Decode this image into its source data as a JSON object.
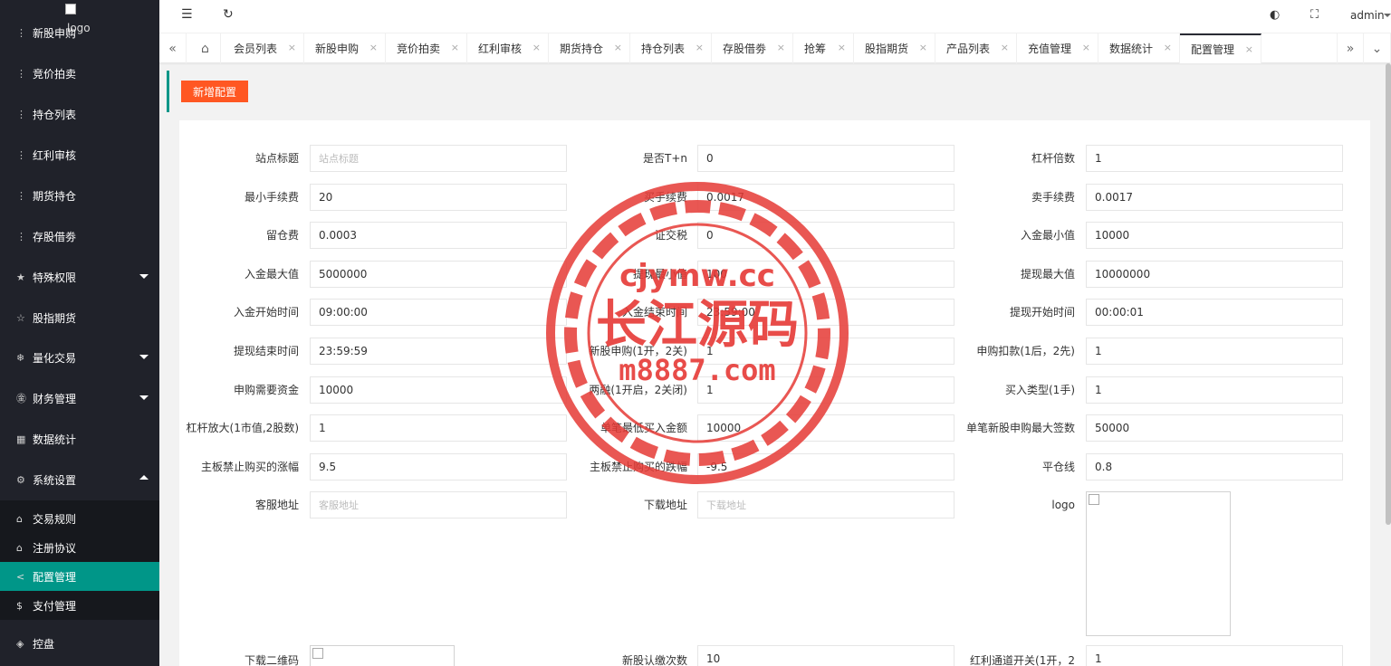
{
  "sidebar": {
    "logo_text": "logo",
    "items": [
      {
        "label": "新股申购",
        "icon": "dots-icon"
      },
      {
        "label": "竞价拍卖",
        "icon": "dots-icon"
      },
      {
        "label": "持仓列表",
        "icon": "dots-icon"
      },
      {
        "label": "红利审核",
        "icon": "dots-icon"
      },
      {
        "label": "期货持仓",
        "icon": "dots-icon"
      },
      {
        "label": "存股借劵",
        "icon": "dots-icon"
      },
      {
        "label": "特殊权限",
        "icon": "star-icon"
      },
      {
        "label": "股指期货",
        "icon": "star-outline-icon"
      },
      {
        "label": "量化交易",
        "icon": "snowflake-icon"
      },
      {
        "label": "财务管理",
        "icon": "yen-icon"
      },
      {
        "label": "数据统计",
        "icon": "calendar-icon"
      },
      {
        "label": "系统设置",
        "icon": "gear-icon"
      }
    ],
    "sub_items": [
      {
        "label": "交易规则",
        "icon": "building-icon"
      },
      {
        "label": "注册协议",
        "icon": "building-icon"
      },
      {
        "label": "配置管理",
        "icon": "share-icon"
      },
      {
        "label": "支付管理",
        "icon": "dollar-icon"
      }
    ],
    "bottom_item": {
      "label": "控盘",
      "icon": "cube-icon"
    }
  },
  "header": {
    "user": "admin"
  },
  "tabs": [
    {
      "label": "会员列表"
    },
    {
      "label": "新股申购"
    },
    {
      "label": "竞价拍卖"
    },
    {
      "label": "红利审核"
    },
    {
      "label": "期货持仓"
    },
    {
      "label": "持仓列表"
    },
    {
      "label": "存股借劵"
    },
    {
      "label": "抢筹"
    },
    {
      "label": "股指期货"
    },
    {
      "label": "产品列表"
    },
    {
      "label": "充值管理"
    },
    {
      "label": "数据统计"
    },
    {
      "label": "配置管理"
    }
  ],
  "toolbar": {
    "add_label": "新增配置"
  },
  "form": {
    "rows": [
      [
        {
          "label": "站点标题",
          "value": "",
          "placeholder": "站点标题"
        },
        {
          "label": "是否T+n",
          "value": "0"
        },
        {
          "label": "杠杆倍数",
          "value": "1"
        }
      ],
      [
        {
          "label": "最小手续费",
          "value": "20"
        },
        {
          "label": "买手续费",
          "value": "0.0017"
        },
        {
          "label": "卖手续费",
          "value": "0.0017"
        }
      ],
      [
        {
          "label": "留仓费",
          "value": "0.0003"
        },
        {
          "label": "证交税",
          "value": "0"
        },
        {
          "label": "入金最小值",
          "value": "10000"
        }
      ],
      [
        {
          "label": "入金最大值",
          "value": "5000000"
        },
        {
          "label": "提现最小值",
          "value": "100"
        },
        {
          "label": "提现最大值",
          "value": "10000000"
        }
      ],
      [
        {
          "label": "入金开始时间",
          "value": "09:00:00"
        },
        {
          "label": "入金结束时间",
          "value": "23:59:00"
        },
        {
          "label": "提现开始时间",
          "value": "00:00:01"
        }
      ],
      [
        {
          "label": "提现结束时间",
          "value": "23:59:59"
        },
        {
          "label": "新股申购(1开，2关)",
          "value": "1"
        },
        {
          "label": "申购扣款(1后，2先)",
          "value": "1"
        }
      ],
      [
        {
          "label": "申购需要资金",
          "value": "10000"
        },
        {
          "label": "两融(1开启，2关闭)",
          "value": "1"
        },
        {
          "label": "买入类型(1手)",
          "value": "1"
        }
      ],
      [
        {
          "label": "杠杆放大(1市值,2股数)",
          "value": "1"
        },
        {
          "label": "单笔最低买入金额",
          "value": "10000"
        },
        {
          "label": "单笔新股申购最大签数",
          "value": "50000"
        }
      ],
      [
        {
          "label": "主板禁止购买的涨幅",
          "value": "9.5"
        },
        {
          "label": "主板禁止购买的跌幅",
          "value": "-9.5"
        },
        {
          "label": "平仓线",
          "value": "0.8"
        }
      ],
      [
        {
          "label": "客服地址",
          "value": "",
          "placeholder": "客服地址"
        },
        {
          "label": "下载地址",
          "value": "",
          "placeholder": "下载地址"
        },
        {
          "label": "logo",
          "value": ""
        }
      ]
    ],
    "last_row": [
      {
        "label": "下载二维码"
      },
      {
        "label": "新股认缴次数",
        "value": "10"
      },
      {
        "label": "红利通道开关(1开，2",
        "value": "1"
      }
    ]
  },
  "watermark": {
    "line1": "cjymw.cc",
    "line2": "长江源码",
    "line3": "m8887.com",
    "color": "#e53935"
  }
}
